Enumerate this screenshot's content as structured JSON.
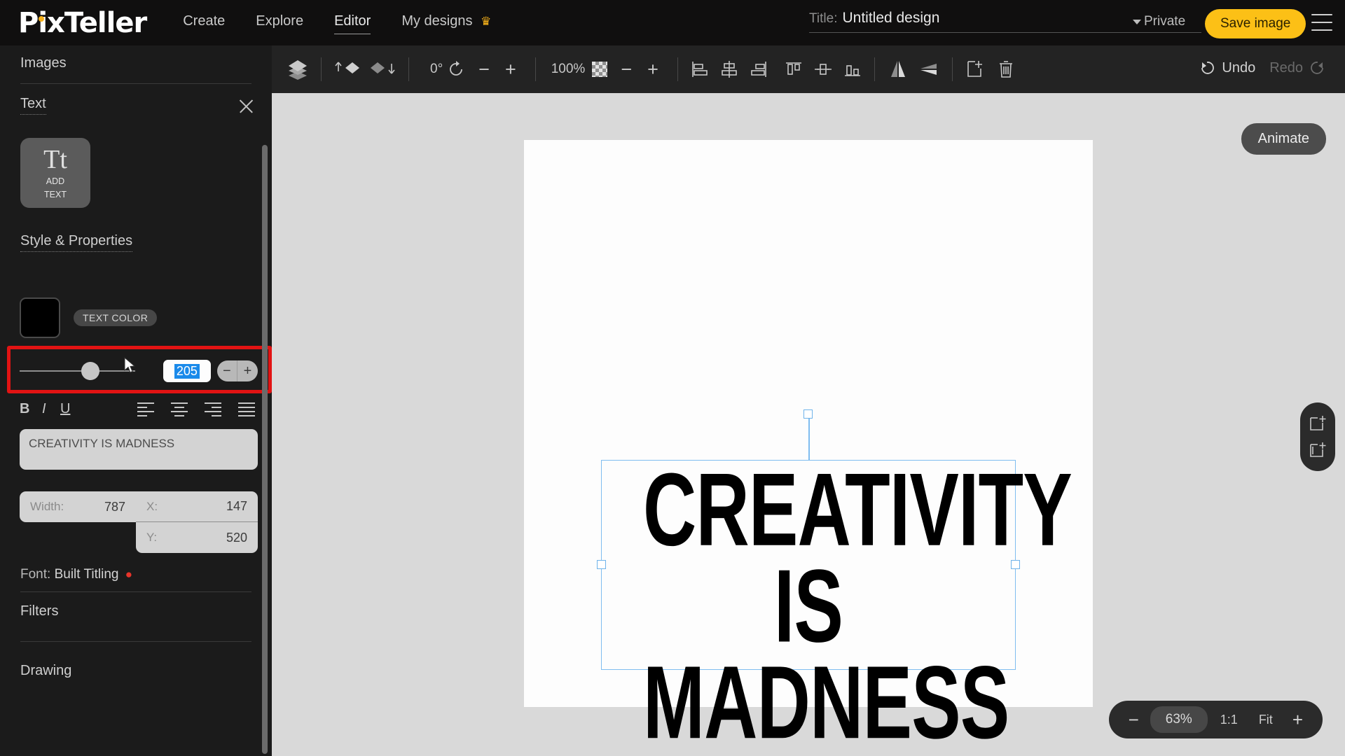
{
  "topnav": {
    "logo": "PixTeller",
    "links": [
      {
        "label": "Create",
        "active": false
      },
      {
        "label": "Explore",
        "active": false
      },
      {
        "label": "Editor",
        "active": true
      },
      {
        "label": "My designs",
        "active": false,
        "icon": "crown-icon"
      }
    ],
    "crown": "♕",
    "title_label": "Title:",
    "title_value": "Untitled design",
    "privacy": "Private",
    "save_label": "Save image",
    "menu_icon": "hamburger-icon",
    "accent_color": "#fcc016"
  },
  "sidebar": {
    "images_section": "Images",
    "text_section": "Text",
    "close_icon": "close-icon",
    "add_text": {
      "glyph": "Tt",
      "line1": "ADD",
      "line2": "TEXT"
    },
    "style_section": "Style & Properties",
    "text_color_label": "TEXT COLOR",
    "text_color_value": "#000000",
    "font_size_value": "205",
    "stepper_minus": "−",
    "stepper_plus": "+",
    "format": {
      "bold": "B",
      "italic": "I",
      "underline": "U"
    },
    "align_icons": [
      "align-left-icon",
      "align-center-icon",
      "align-right-icon",
      "align-justify-icon"
    ],
    "text_content": "CREATIVITY IS MADNESS",
    "fields": [
      {
        "label": "Width:",
        "value": "787"
      },
      {
        "label": "X:",
        "value": "147"
      },
      {
        "label": "Y:",
        "value": "520"
      }
    ],
    "font_label": "Font:",
    "font_name": "Built Titling",
    "font_badge": "🔥",
    "filters_section": "Filters",
    "drawing_section": "Drawing",
    "highlight_color": "#e21313"
  },
  "toolbar": {
    "layers_icon": "layers-icon",
    "bring_forward_icon": "bring-forward-icon",
    "send_backward_icon": "send-backward-icon",
    "rotation_value": "0°",
    "rotate_icon": "rotate-icon",
    "rotate_minus": "−",
    "rotate_plus": "+",
    "opacity_value": "100%",
    "opacity_icon": "checkerboard-icon",
    "opacity_minus": "−",
    "opacity_plus": "+",
    "align_h_icons": [
      "align-h-left-icon",
      "align-h-center-icon",
      "align-h-right-icon"
    ],
    "align_v_icons": [
      "align-v-top-icon",
      "align-v-middle-icon",
      "align-v-bottom-icon"
    ],
    "flip_icons": [
      "flip-horizontal-icon",
      "flip-vertical-icon"
    ],
    "duplicate_icon": "duplicate-icon",
    "delete_icon": "trash-icon",
    "undo_label": "Undo",
    "redo_label": "Redo",
    "undo_icon": "undo-arrow-icon",
    "redo_icon": "redo-arrow-icon"
  },
  "canvas": {
    "text_line1": "CREATIVITY IS",
    "text_line2": "MADNESS",
    "animate_label": "Animate",
    "add_image_icon": "add-image-icon",
    "add_text_layer_icon": "add-text-layer-icon",
    "selection_color": "#7fbdf0"
  },
  "zoombar": {
    "minus": "−",
    "percent": "63%",
    "one_to_one": "1:1",
    "fit": "Fit",
    "plus": "+"
  }
}
